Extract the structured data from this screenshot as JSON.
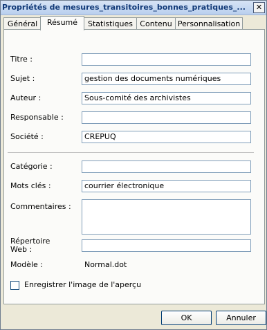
{
  "window": {
    "title": "Propriétés de mesures_transitoires_bonnes_pratiques_...",
    "close_glyph": "✕"
  },
  "tabs": [
    {
      "label": "Général"
    },
    {
      "label": "Résumé"
    },
    {
      "label": "Statistiques"
    },
    {
      "label": "Contenu"
    },
    {
      "label": "Personnalisation"
    }
  ],
  "active_tab": "Résumé",
  "summary": {
    "titre": {
      "label": "Titre :",
      "value": ""
    },
    "sujet": {
      "label": "Sujet :",
      "value": "gestion des documents numériques"
    },
    "auteur": {
      "label": "Auteur :",
      "value": "Sous-comité des archivistes"
    },
    "responsable": {
      "label": "Responsable :",
      "value": ""
    },
    "societe": {
      "label": "Société :",
      "value": "CREPUQ"
    },
    "categorie": {
      "label": "Catégorie :",
      "value": ""
    },
    "mots_cles": {
      "label": "Mots clés :",
      "value": "courrier électronique"
    },
    "commentaires": {
      "label": "Commentaires :",
      "value": ""
    },
    "repertoire_web": {
      "label": "Répertoire Web :",
      "value": ""
    },
    "modele": {
      "label": "Modèle :",
      "value": "Normal.dot"
    },
    "save_preview": {
      "label": "Enregistrer l'image de l'aperçu",
      "checked": false
    }
  },
  "buttons": {
    "ok": "OK",
    "cancel": "Annuler"
  }
}
